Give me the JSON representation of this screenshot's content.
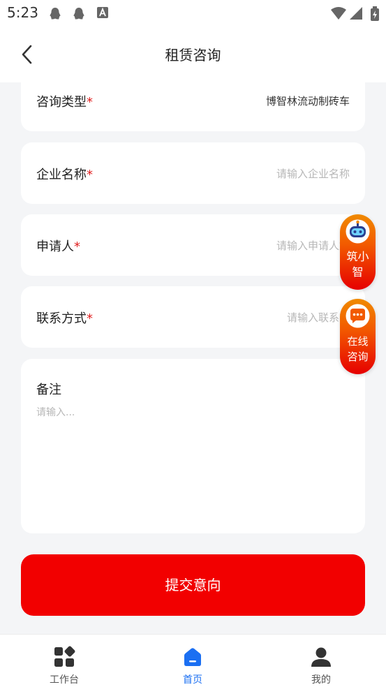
{
  "status_bar": {
    "time": "5:23"
  },
  "nav": {
    "title": "租赁咨询"
  },
  "form": {
    "consult_type": {
      "label": "咨询类型",
      "required_mark": "*",
      "value": "博智林流动制砖车"
    },
    "company_name": {
      "label": "企业名称",
      "required_mark": "*",
      "placeholder": "请输入企业名称"
    },
    "applicant": {
      "label": "申请人",
      "required_mark": "*",
      "placeholder": "请输入申请人姓"
    },
    "contact": {
      "label": "联系方式",
      "required_mark": "*",
      "placeholder": "请输入联系方"
    },
    "remark": {
      "label": "备注",
      "placeholder": "请输入..."
    }
  },
  "submit_label": "提交意向",
  "floating": {
    "assistant_label": "筑小智",
    "online_label_1": "在线",
    "online_label_2": "咨询"
  },
  "tabs": [
    {
      "label": "工作台",
      "icon": "grid-icon",
      "active": false
    },
    {
      "label": "首页",
      "icon": "home-icon",
      "active": true
    },
    {
      "label": "我的",
      "icon": "person-icon",
      "active": false
    }
  ],
  "colors": {
    "primary_red": "#f20000",
    "active_blue": "#1b6ff2",
    "required_red": "#e02020"
  }
}
